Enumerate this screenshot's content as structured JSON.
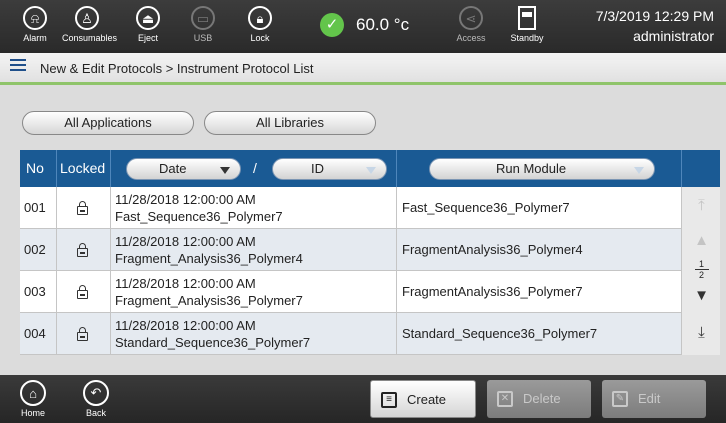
{
  "topbar": {
    "buttons": [
      {
        "id": "alarm",
        "label": "Alarm",
        "icon": "bell-icon"
      },
      {
        "id": "consumables",
        "label": "Consumables",
        "icon": "bottle-icon"
      },
      {
        "id": "eject",
        "label": "Eject",
        "icon": "eject-icon"
      },
      {
        "id": "usb",
        "label": "USB",
        "icon": "usb-icon"
      },
      {
        "id": "lock",
        "label": "Lock",
        "icon": "lock-icon"
      },
      {
        "id": "access",
        "label": "Access",
        "icon": "share-icon"
      },
      {
        "id": "standby",
        "label": "Standby",
        "icon": "standby-icon"
      }
    ],
    "temperature": "60.0 °c",
    "temperature_status_color": "#63c54b",
    "date_time": "7/3/2019 12:29 PM",
    "user": "administrator"
  },
  "breadcrumb": "New & Edit Protocols > Instrument Protocol List",
  "filters": {
    "applications": "All Applications",
    "libraries": "All Libraries"
  },
  "table": {
    "headers": {
      "no": "No",
      "locked": "Locked",
      "date": "Date",
      "separator": "/",
      "id": "ID",
      "run_module": "Run Module"
    },
    "rows": [
      {
        "no": "001",
        "date": "11/28/2018 12:00:00 AM",
        "protocol": "Fast_Sequence36_Polymer7",
        "run_module": "Fast_Sequence36_Polymer7"
      },
      {
        "no": "002",
        "date": "11/28/2018 12:00:00 AM",
        "protocol": "Fragment_Analysis36_Polymer4",
        "run_module": "FragmentAnalysis36_Polymer4"
      },
      {
        "no": "003",
        "date": "11/28/2018 12:00:00 AM",
        "protocol": "Fragment_Analysis36_Polymer7",
        "run_module": "FragmentAnalysis36_Polymer7"
      },
      {
        "no": "004",
        "date": "11/28/2018 12:00:00 AM",
        "protocol": "Standard_Sequence36_Polymer7",
        "run_module": "Standard_Sequence36_Polymer7"
      }
    ],
    "header_color": "#1a5a94"
  },
  "pager": {
    "current": "1",
    "total": "2"
  },
  "bottombar": {
    "home": "Home",
    "back": "Back",
    "create": "Create",
    "delete": "Delete",
    "edit": "Edit"
  }
}
